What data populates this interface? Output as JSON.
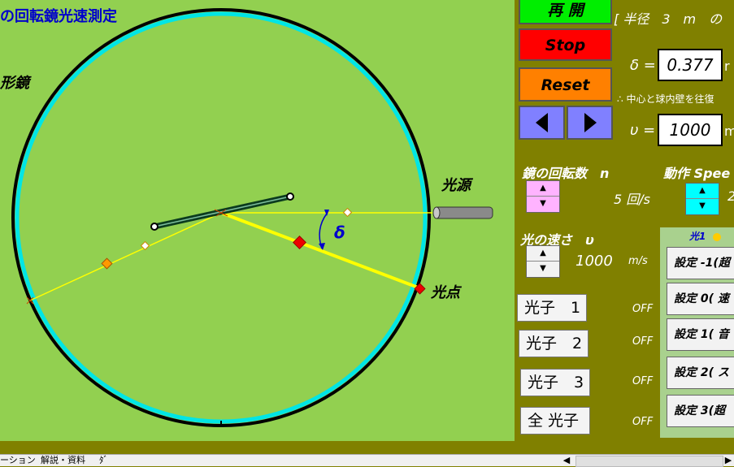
{
  "sim": {
    "title": "の回転鏡光速測定",
    "mirror_label": "形鏡",
    "source_label": "光源",
    "spot_label": "光点",
    "delta_symbol": "δ"
  },
  "controls": {
    "replay_label": "再 開",
    "stop_label": "Stop",
    "reset_label": "Reset",
    "prev_icon": "triangle-left",
    "next_icon": "triangle-right",
    "radius_text": "[ 半径　3　m　の",
    "delta_label": "δ =",
    "delta_value": "0.377",
    "delta_unit": "r",
    "roundtrip_note": "∴ 中心と球内壁を往復",
    "v_label": "υ =",
    "v_value": "1000",
    "v_unit": "m",
    "rotation_label": "鏡の回転数　n",
    "rotation_value": "5 回/s",
    "action_label": "動作 Spee",
    "action_value": "2",
    "speed_label": "光の速さ　υ",
    "speed_value": "1000",
    "speed_unit": "m/s",
    "spin_up": "▲",
    "spin_down": "▼"
  },
  "photons": [
    {
      "label": "光子　1",
      "status": "OFF"
    },
    {
      "label": "光子　2",
      "status": "OFF"
    },
    {
      "label": "光子　3",
      "status": "OFF"
    },
    {
      "label": "全 光子",
      "status": "OFF"
    }
  ],
  "presets": {
    "header": "光1",
    "items": [
      "設定 -1(超",
      "設定 0( 速",
      "設定 1( 音",
      "設定 2( ス",
      "設定 3(超"
    ]
  },
  "sheet_tabs": {
    "tab1": "ーション",
    "tab2": "解説・資料",
    "tab3": "ﾀﾞ"
  },
  "colors": {
    "field": "#92d050",
    "panel": "#808000",
    "replay": "#00ee00",
    "stop": "#ff0000",
    "reset": "#ff8000",
    "nav": "#8080ff",
    "spin_pink": "#ffb3ff",
    "spin_cyan": "#00ffff",
    "ring_outer": "#000000",
    "ring_inner": "#00e5e5",
    "beam": "#ffff00"
  }
}
